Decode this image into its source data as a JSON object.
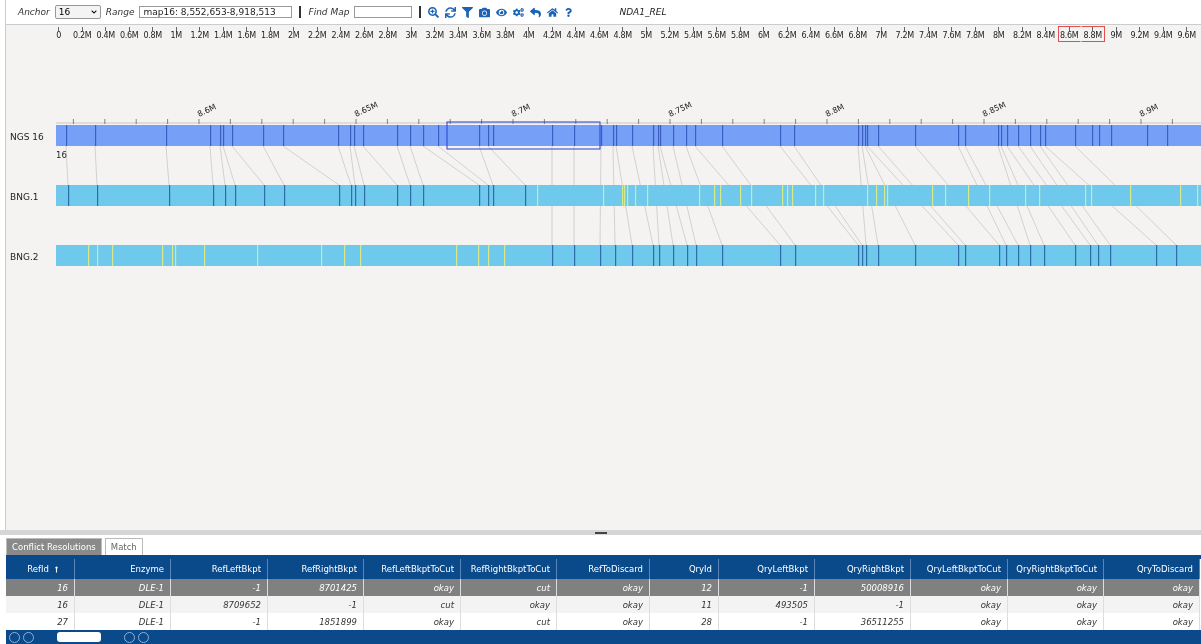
{
  "toolbar": {
    "anchor_label": "Anchor",
    "anchor_value": "16",
    "range_label": "Range",
    "range_value": "map16: 8,552,653-8,918,513",
    "find_label": "Find Map",
    "dataset": "NDA1_REL"
  },
  "ruler": {
    "ticks": [
      {
        "label": "0",
        "highlighted": false
      },
      {
        "label": "0.2M",
        "highlighted": false
      },
      {
        "label": "0.4M",
        "highlighted": false
      },
      {
        "label": "0.6M",
        "highlighted": false
      },
      {
        "label": "0.8M",
        "highlighted": false
      },
      {
        "label": "1M",
        "highlighted": false
      },
      {
        "label": "1.2M",
        "highlighted": false
      },
      {
        "label": "1.4M",
        "highlighted": false
      },
      {
        "label": "1.6M",
        "highlighted": false
      },
      {
        "label": "1.8M",
        "highlighted": false
      },
      {
        "label": "2M",
        "highlighted": false
      },
      {
        "label": "2.2M",
        "highlighted": false
      },
      {
        "label": "2.4M",
        "highlighted": false
      },
      {
        "label": "2.6M",
        "highlighted": false
      },
      {
        "label": "2.8M",
        "highlighted": false
      },
      {
        "label": "3M",
        "highlighted": false
      },
      {
        "label": "3.2M",
        "highlighted": false
      },
      {
        "label": "3.4M",
        "highlighted": false
      },
      {
        "label": "3.6M",
        "highlighted": false
      },
      {
        "label": "3.8M",
        "highlighted": false
      },
      {
        "label": "4M",
        "highlighted": false
      },
      {
        "label": "4.2M",
        "highlighted": false
      },
      {
        "label": "4.4M",
        "highlighted": false
      },
      {
        "label": "4.6M",
        "highlighted": false
      },
      {
        "label": "4.8M",
        "highlighted": false
      },
      {
        "label": "5M",
        "highlighted": false
      },
      {
        "label": "5.2M",
        "highlighted": false
      },
      {
        "label": "5.4M",
        "highlighted": false
      },
      {
        "label": "5.6M",
        "highlighted": false
      },
      {
        "label": "5.8M",
        "highlighted": false
      },
      {
        "label": "6M",
        "highlighted": false
      },
      {
        "label": "6.2M",
        "highlighted": false
      },
      {
        "label": "6.4M",
        "highlighted": false
      },
      {
        "label": "6.6M",
        "highlighted": false
      },
      {
        "label": "6.8M",
        "highlighted": false
      },
      {
        "label": "7M",
        "highlighted": false
      },
      {
        "label": "7.2M",
        "highlighted": false
      },
      {
        "label": "7.4M",
        "highlighted": false
      },
      {
        "label": "7.6M",
        "highlighted": false
      },
      {
        "label": "7.8M",
        "highlighted": false
      },
      {
        "label": "8M",
        "highlighted": false
      },
      {
        "label": "8.2M",
        "highlighted": false
      },
      {
        "label": "8.4M",
        "highlighted": false
      },
      {
        "label": "8.6M",
        "highlighted": true
      },
      {
        "label": "8.8M",
        "highlighted": true
      },
      {
        "label": "9M",
        "highlighted": false
      },
      {
        "label": "9.2M",
        "highlighted": false
      },
      {
        "label": "9.4M",
        "highlighted": false
      },
      {
        "label": "9.6M",
        "highlighted": false
      }
    ]
  },
  "map_view": {
    "axis_labels": [
      "8.6M",
      "8.65M",
      "8.7M",
      "8.75M",
      "8.8M",
      "8.85M",
      "8.9M"
    ],
    "tracks": [
      {
        "name": "NGS 16",
        "kind": "reference",
        "id_label": "16"
      },
      {
        "name": "BNG.1",
        "kind": "query"
      },
      {
        "name": "BNG.2",
        "kind": "query"
      }
    ]
  },
  "tabs": [
    {
      "label": "Conflict Resolutions",
      "selected": true
    },
    {
      "label": "Match",
      "selected": false
    }
  ],
  "table": {
    "columns": [
      {
        "label": "RefId",
        "sorted": true
      },
      {
        "label": "Enzyme",
        "sorted": false
      },
      {
        "label": "RefLeftBkpt",
        "sorted": false
      },
      {
        "label": "RefRightBkpt",
        "sorted": false
      },
      {
        "label": "RefLeftBkptToCut",
        "sorted": false
      },
      {
        "label": "RefRightBkptToCut",
        "sorted": false
      },
      {
        "label": "RefToDiscard",
        "sorted": false
      },
      {
        "label": "QryId",
        "sorted": false
      },
      {
        "label": "QryLeftBkpt",
        "sorted": false
      },
      {
        "label": "QryRightBkpt",
        "sorted": false
      },
      {
        "label": "QryLeftBkptToCut",
        "sorted": false
      },
      {
        "label": "QryRightBkptToCut",
        "sorted": false
      },
      {
        "label": "QryToDiscard",
        "sorted": false
      }
    ],
    "rows": [
      {
        "selected": true,
        "cells": [
          "16",
          "DLE-1",
          "-1",
          "8701425",
          "okay",
          "cut",
          "okay",
          "12",
          "-1",
          "50008916",
          "okay",
          "okay",
          "okay"
        ]
      },
      {
        "selected": false,
        "cells": [
          "16",
          "DLE-1",
          "8709652",
          "-1",
          "cut",
          "okay",
          "okay",
          "11",
          "493505",
          "-1",
          "okay",
          "okay",
          "okay"
        ]
      },
      {
        "selected": false,
        "cells": [
          "27",
          "DLE-1",
          "-1",
          "1851899",
          "okay",
          "cut",
          "okay",
          "28",
          "-1",
          "36511255",
          "okay",
          "okay",
          "okay"
        ]
      }
    ]
  }
}
